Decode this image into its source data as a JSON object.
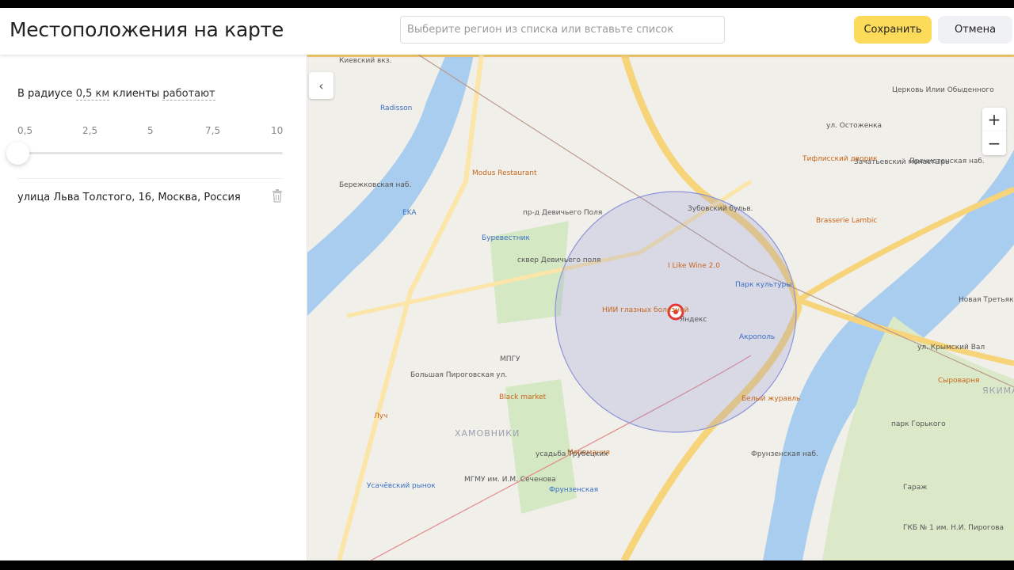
{
  "header": {
    "title": "Местоположения на карте",
    "search_placeholder": "Выберите регион из списка или вставьте список",
    "save_label": "Сохранить",
    "cancel_label": "Отмена"
  },
  "filter": {
    "prefix": "В радиусе",
    "radius": "0,5 км",
    "middle": "клиенты",
    "status": "работают"
  },
  "slider": {
    "ticks": [
      "0,5",
      "2,5",
      "5",
      "7,5",
      "10"
    ],
    "value_km": 0.5
  },
  "locations": [
    {
      "address": "улица Льва Толстого, 16, Москва, Россия"
    }
  ],
  "map": {
    "zoom_in": "+",
    "zoom_out": "−",
    "labels": [
      {
        "text": "Киевский вкз.",
        "c": ""
      },
      {
        "text": "Radisson",
        "c": "blue"
      },
      {
        "text": "Бережковская наб.",
        "c": ""
      },
      {
        "text": "Modus Restaurant",
        "c": "orange"
      },
      {
        "text": "EKA",
        "c": "blue"
      },
      {
        "text": "Буревестник",
        "c": "blue"
      },
      {
        "text": "сквер Девичьего поля",
        "c": ""
      },
      {
        "text": "пр-д Девичьего Поля",
        "c": ""
      },
      {
        "text": "Зубовский бульв.",
        "c": ""
      },
      {
        "text": "I Like Wine 2.0",
        "c": "orange"
      },
      {
        "text": "НИИ глазных болезней",
        "c": "orange"
      },
      {
        "text": "Яндекс",
        "c": ""
      },
      {
        "text": "Парк культуры",
        "c": "blue"
      },
      {
        "text": "Акрополь",
        "c": "blue"
      },
      {
        "text": "МПГУ",
        "c": ""
      },
      {
        "text": "Black market",
        "c": "orange"
      },
      {
        "text": "ХАМОВНИКИ",
        "c": "dist"
      },
      {
        "text": "Моремания",
        "c": "orange"
      },
      {
        "text": "усадьба Трубецких",
        "c": ""
      },
      {
        "text": "МГМУ им. И.М. Сеченова",
        "c": ""
      },
      {
        "text": "Фрунзенская",
        "c": "blue"
      },
      {
        "text": "Белый журавль",
        "c": "orange"
      },
      {
        "text": "Сыроварня",
        "c": "orange"
      },
      {
        "text": "парк Горького",
        "c": ""
      },
      {
        "text": "ЯКИМАНКА",
        "c": "dist"
      },
      {
        "text": "Новая Третьяковка",
        "c": ""
      },
      {
        "text": "ул. Крымский Вал",
        "c": ""
      },
      {
        "text": "Тифлисский дворик",
        "c": "orange"
      },
      {
        "text": "Зачатьевский монастырь",
        "c": ""
      },
      {
        "text": "Церковь Илии Обыденного",
        "c": ""
      },
      {
        "text": "Brasserie Lambic",
        "c": "orange"
      },
      {
        "text": "Пречистенская наб.",
        "c": ""
      },
      {
        "text": "Луч",
        "c": "orange"
      },
      {
        "text": "Усачёвский рынок",
        "c": "blue"
      },
      {
        "text": "Гараж",
        "c": ""
      },
      {
        "text": "ГКБ № 1 им. Н.И. Пирогова",
        "c": ""
      },
      {
        "text": "Большая Пироговская ул.",
        "c": ""
      },
      {
        "text": "Фрунзенская наб.",
        "c": ""
      },
      {
        "text": "ул. Остоженка",
        "c": ""
      }
    ]
  }
}
